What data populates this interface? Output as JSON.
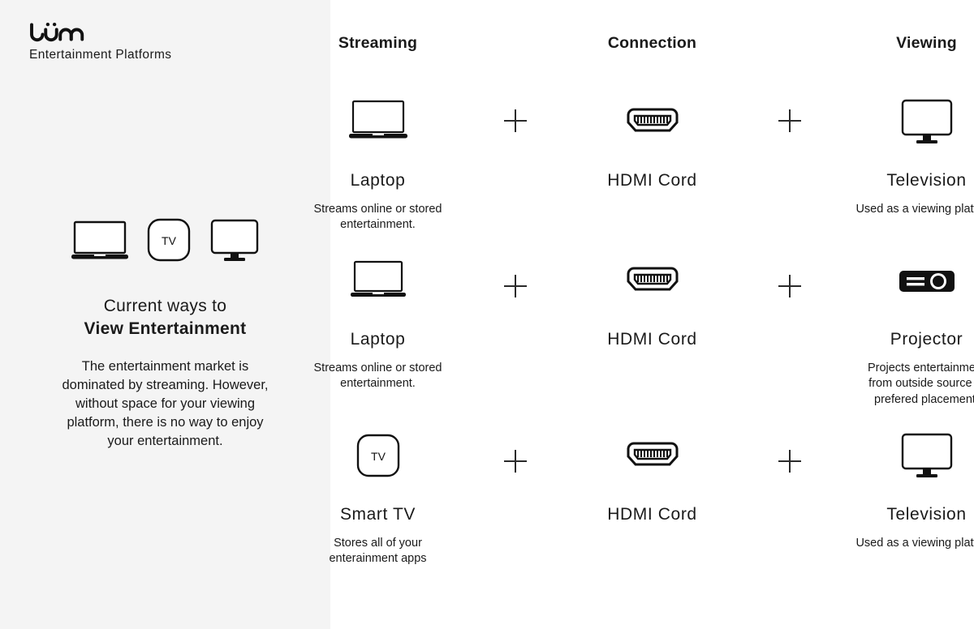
{
  "brand": {
    "logo_text": "lüm",
    "logo_icon": "lum-wordmark-logo",
    "subtitle": "Entertainment Platforms"
  },
  "sidebar": {
    "icons": [
      {
        "name": "laptop-icon",
        "label": "Laptop"
      },
      {
        "name": "smart-tv-icon",
        "label": "TV"
      },
      {
        "name": "television-icon",
        "label": "Television"
      }
    ],
    "smart_tv_glyph": "TV",
    "headline_line1": "Current ways to",
    "headline_line2": "View Entertainment",
    "blurb": "The entertainment market is dominated by streaming. However, without space for your viewing platform, there is no way to enjoy your entertainment.",
    "background_color": "#f4f4f4"
  },
  "columns": [
    {
      "label": "Streaming"
    },
    {
      "label": "Connection"
    },
    {
      "label": "Viewing"
    }
  ],
  "operator": "+",
  "rows": [
    {
      "streaming": {
        "icon": "laptop-icon",
        "label": "Laptop",
        "desc": "Streams online or stored entertainment."
      },
      "connection": {
        "icon": "hdmi-cord-icon",
        "label": "HDMI Cord",
        "desc": ""
      },
      "viewing": {
        "icon": "television-icon",
        "label": "Television",
        "desc": "Used as a viewing platform"
      }
    },
    {
      "streaming": {
        "icon": "laptop-icon",
        "label": "Laptop",
        "desc": "Streams online or stored entertainment."
      },
      "connection": {
        "icon": "hdmi-cord-icon",
        "label": "HDMI Cord",
        "desc": ""
      },
      "viewing": {
        "icon": "projector-icon",
        "label": "Projector",
        "desc": "Projects entertainment from outside source in prefered placement."
      }
    },
    {
      "streaming": {
        "icon": "smart-tv-icon",
        "label": "Smart TV",
        "desc": "Stores all of your enterainment apps"
      },
      "connection": {
        "icon": "hdmi-cord-icon",
        "label": "HDMI Cord",
        "desc": ""
      },
      "viewing": {
        "icon": "television-icon",
        "label": "Television",
        "desc": "Used as a viewing platform"
      }
    }
  ],
  "smart_tv_glyph": "TV",
  "colors": {
    "ink": "#1a1a1a",
    "panel": "#f4f4f4",
    "canvas": "#ffffff"
  }
}
